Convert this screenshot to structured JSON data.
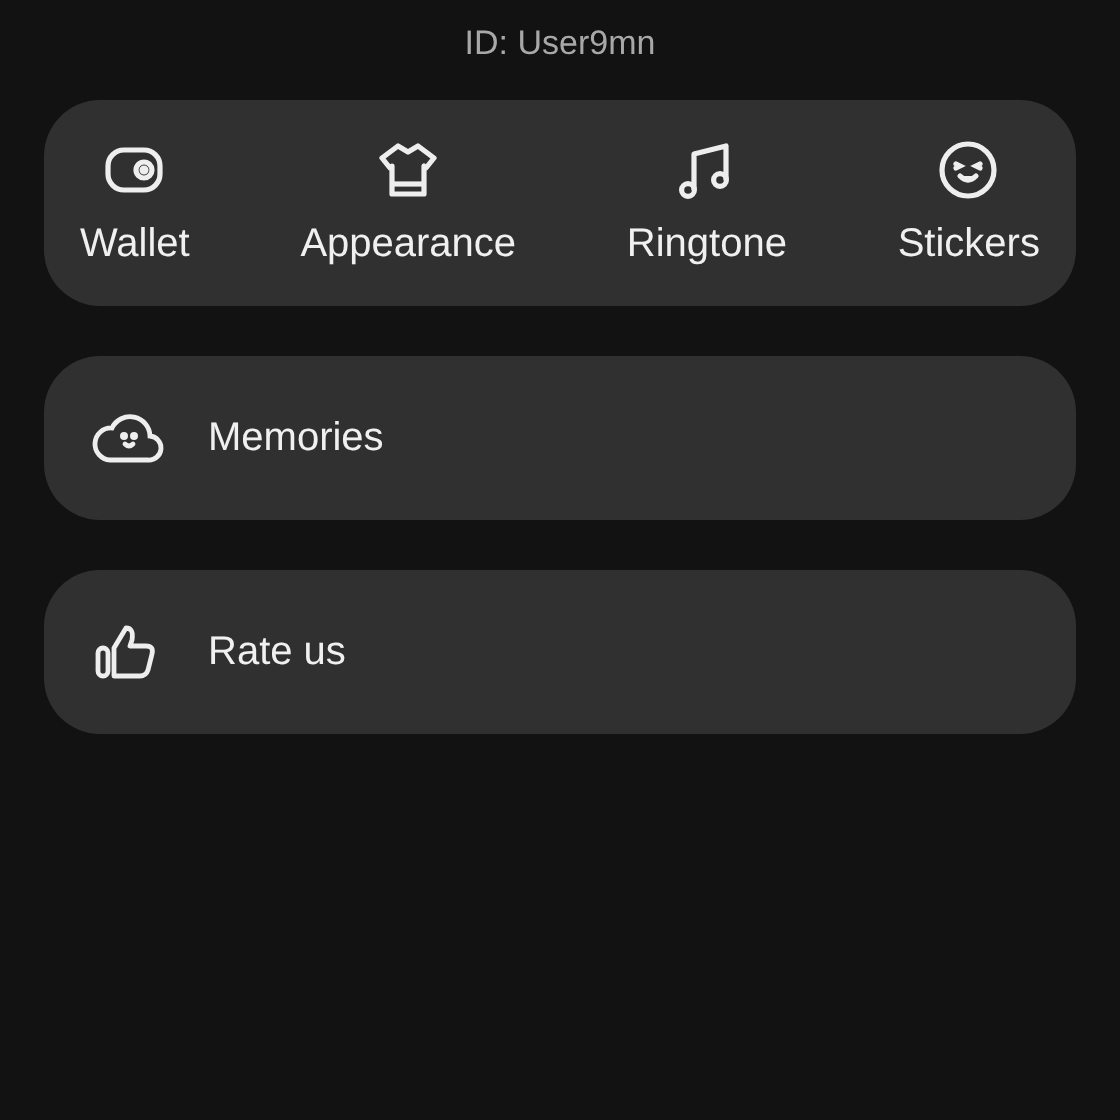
{
  "profile": {
    "user_id": "ID: User9mn"
  },
  "shortcuts": [
    {
      "label": "Wallet"
    },
    {
      "label": "Appearance"
    },
    {
      "label": "Ringtone"
    },
    {
      "label": "Stickers"
    }
  ],
  "menu": [
    {
      "label": "Memories"
    },
    {
      "label": "Rate us"
    }
  ]
}
